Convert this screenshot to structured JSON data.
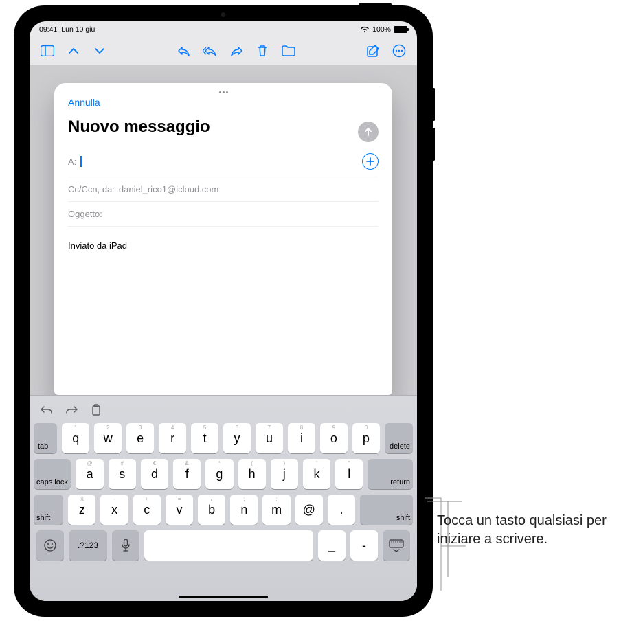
{
  "statusbar": {
    "time": "09:41",
    "date": "Lun 10 giu",
    "battery_pct": "100%"
  },
  "compose": {
    "cancel": "Annulla",
    "title": "Nuovo messaggio",
    "to_label": "A:",
    "cc_label": "Cc/Ccn, da:",
    "cc_value": "daniel_rico1@icloud.com",
    "subject_label": "Oggetto:",
    "body_signature": "Inviato da iPad"
  },
  "keyboard": {
    "row1": [
      {
        "main": "q",
        "sub": "1"
      },
      {
        "main": "w",
        "sub": "2"
      },
      {
        "main": "e",
        "sub": "3"
      },
      {
        "main": "r",
        "sub": "4"
      },
      {
        "main": "t",
        "sub": "5"
      },
      {
        "main": "y",
        "sub": "6"
      },
      {
        "main": "u",
        "sub": "7"
      },
      {
        "main": "i",
        "sub": "8"
      },
      {
        "main": "o",
        "sub": "9"
      },
      {
        "main": "p",
        "sub": "0"
      }
    ],
    "row2": [
      {
        "main": "a",
        "sub": "@"
      },
      {
        "main": "s",
        "sub": "#"
      },
      {
        "main": "d",
        "sub": "€"
      },
      {
        "main": "f",
        "sub": "&"
      },
      {
        "main": "g",
        "sub": "*"
      },
      {
        "main": "h",
        "sub": "("
      },
      {
        "main": "j",
        "sub": ")"
      },
      {
        "main": "k",
        "sub": "'"
      },
      {
        "main": "l",
        "sub": "\""
      }
    ],
    "row3": [
      {
        "main": "z",
        "sub": "%"
      },
      {
        "main": "x",
        "sub": "-"
      },
      {
        "main": "c",
        "sub": "+"
      },
      {
        "main": "v",
        "sub": "="
      },
      {
        "main": "b",
        "sub": "/"
      },
      {
        "main": "n",
        "sub": ";"
      },
      {
        "main": "m",
        "sub": ":"
      },
      {
        "main": "@",
        "sub": ""
      },
      {
        "main": ".",
        "sub": ""
      }
    ],
    "tab": "tab",
    "delete": "delete",
    "caps": "caps lock",
    "return": "return",
    "shift": "shift",
    "numkey": ".?123",
    "underscore": "_",
    "dash": "-"
  },
  "callout": {
    "text": "Tocca un tasto qualsiasi per iniziare a scrivere."
  }
}
